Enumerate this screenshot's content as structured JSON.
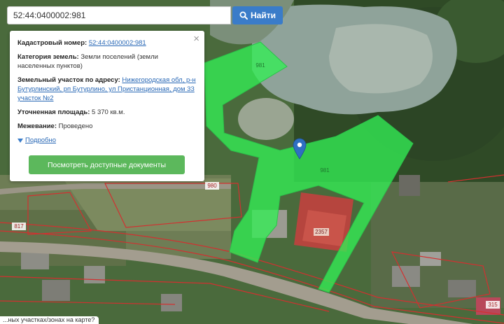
{
  "search": {
    "value": "52:44:0400002:981",
    "button_label": "Найти"
  },
  "popup": {
    "close_label": "×",
    "cadastral": {
      "label": "Кадастровый номер:",
      "value": "52:44:0400002:981"
    },
    "category": {
      "label": "Категория земель:",
      "value": "Земли поселений (земли населенных пунктов)"
    },
    "address": {
      "label": "Земельный участок по адресу:",
      "value": "Нижегородская обл, р-н Бутурлинский, рп Бутурлино, ул Пристанционная, дом 33 участок №2"
    },
    "area": {
      "label": "Уточненная площадь:",
      "value": "5 370 кв.м."
    },
    "survey": {
      "label": "Межевание:",
      "value": "Проведено"
    },
    "more_label": "Подробно",
    "docs_button": "Посмотреть доступные документы"
  },
  "map": {
    "plot_labels": [
      "981",
      "981",
      "2357",
      "980",
      "817",
      "315"
    ],
    "highlight_color": "#33ee55",
    "boundary_color": "#d23030",
    "marker_color": "#2f6fc2"
  },
  "bottom_text": "...ных участках/зонах на карте?"
}
